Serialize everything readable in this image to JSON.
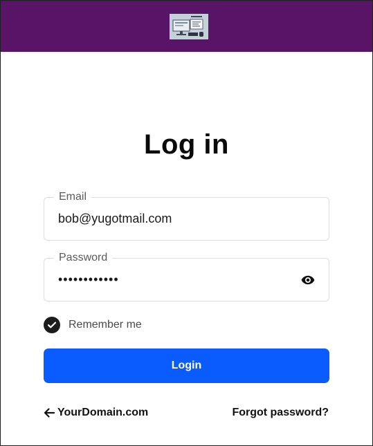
{
  "header": {
    "background_color": "#581466",
    "logo_icon": "computer-illustration-logo"
  },
  "form": {
    "title": "Log in",
    "email": {
      "label": "Email",
      "value": "bob@yugotmail.com"
    },
    "password": {
      "label": "Password",
      "value": "••••••••••••",
      "toggle_icon": "eye-icon"
    },
    "remember": {
      "label": "Remember me",
      "checked": true
    },
    "submit_label": "Login",
    "submit_color": "#0a5cff"
  },
  "footer": {
    "back_link": "YourDomain.com",
    "back_icon": "arrow-left-icon",
    "forgot_link": "Forgot password?"
  }
}
